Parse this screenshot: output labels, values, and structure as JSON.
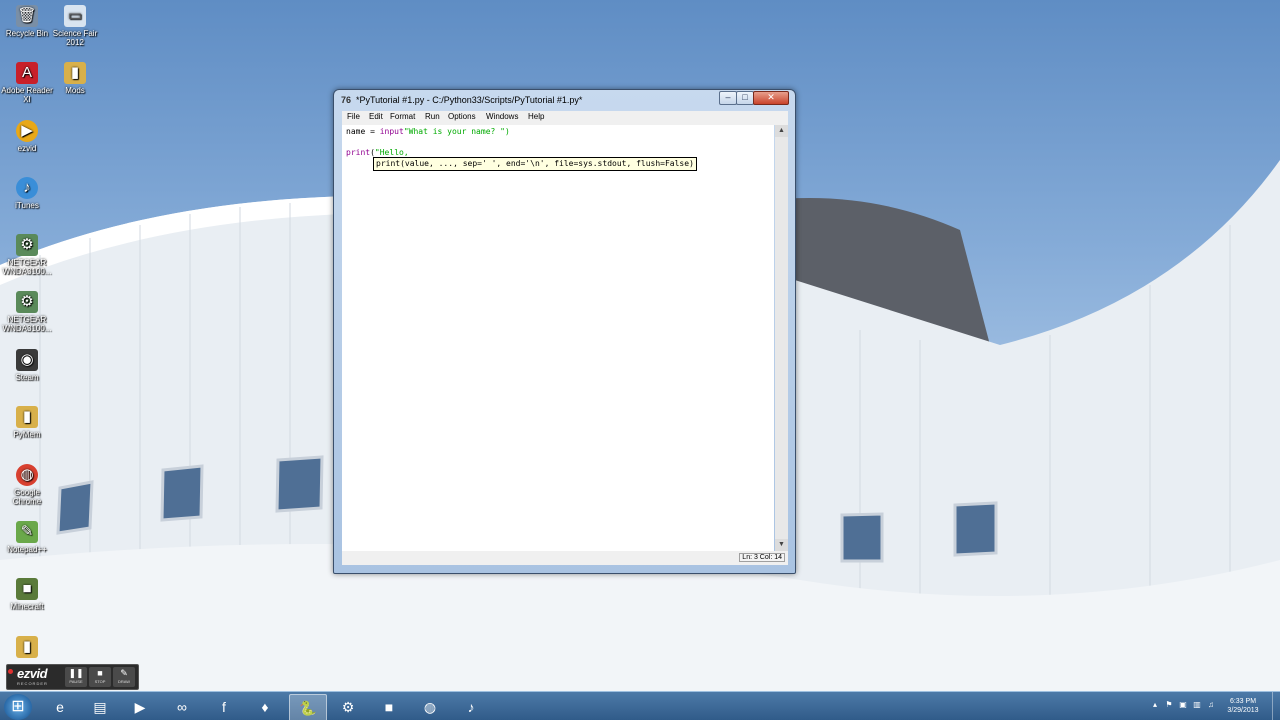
{
  "desktop": {
    "icons": [
      {
        "label": "Recycle Bin",
        "glyph": "🗑",
        "color": "#7a8fa6"
      },
      {
        "label": "Science Fair 2012",
        "glyph": "▭",
        "color": "#d8e4f0"
      },
      {
        "label": "Adobe Reader XI",
        "glyph": "A",
        "color": "#c8202a"
      },
      {
        "label": "Mods",
        "glyph": "▮",
        "color": "#d8b04a"
      },
      {
        "label": "ezvid",
        "glyph": "▶",
        "color": "#e8a818"
      },
      {
        "label": "iTunes",
        "glyph": "♪",
        "color": "#3a8ed8"
      },
      {
        "label": "NETGEAR WNDA3100...",
        "glyph": "⚙",
        "color": "#5a8a5a"
      },
      {
        "label": "NETGEAR WNDA3100...",
        "glyph": "⚙",
        "color": "#5a8a5a"
      },
      {
        "label": "Steam",
        "glyph": "◉",
        "color": "#3a3a3a"
      },
      {
        "label": "PyMem",
        "glyph": "▮",
        "color": "#d8b04a"
      },
      {
        "label": "Google Chrome",
        "glyph": "◍",
        "color": "#d84030"
      },
      {
        "label": "Notepad++",
        "glyph": "✎",
        "color": "#6aa84a"
      },
      {
        "label": "Minecraft",
        "glyph": "■",
        "color": "#5a7a3a"
      },
      {
        "label": "",
        "glyph": "▮",
        "color": "#d8b04a"
      }
    ]
  },
  "window": {
    "title": "*PyTutorial #1.py - C:/Python33/Scripts/PyTutorial #1.py*",
    "app_icon": "76",
    "minimize": "–",
    "maximize": "□",
    "close": "✕",
    "menu": [
      "File",
      "Edit",
      "Format",
      "Run",
      "Options",
      "Windows",
      "Help"
    ],
    "code": {
      "line1_var": "name = ",
      "line1_func": "input",
      "line1_str": "\"What is your name? \")",
      "line3_func": "print",
      "line3_rest": "(",
      "line3_str": "\"Hello,"
    },
    "calltip": "print(value, ..., sep=' ', end='\\n', file=sys.stdout, flush=False)",
    "status": "Ln: 3 Col: 14",
    "scroll_up": "▲",
    "scroll_down": "▼"
  },
  "recorder": {
    "logo": "ezvid",
    "subtitle": "RECORDER",
    "buttons": [
      {
        "glyph": "❚❚",
        "label": "PAUSE"
      },
      {
        "glyph": "■",
        "label": "STOP"
      },
      {
        "glyph": "✎",
        "label": "DRAW"
      }
    ]
  },
  "taskbar": {
    "start_glyph": "⊞",
    "apps": [
      {
        "name": "internet-explorer",
        "glyph": "e",
        "active": false
      },
      {
        "name": "file-explorer",
        "glyph": "▤",
        "active": false
      },
      {
        "name": "media-player",
        "glyph": "▶",
        "active": false
      },
      {
        "name": "arduino",
        "glyph": "∞",
        "active": false
      },
      {
        "name": "flash",
        "glyph": "f",
        "active": false
      },
      {
        "name": "red-app",
        "glyph": "♦",
        "active": false
      },
      {
        "name": "python-idle",
        "glyph": "🐍",
        "active": true
      },
      {
        "name": "tools",
        "glyph": "⚙",
        "active": false
      },
      {
        "name": "minecraft",
        "glyph": "■",
        "active": false
      },
      {
        "name": "chrome",
        "glyph": "◍",
        "active": false
      },
      {
        "name": "itunes",
        "glyph": "♪",
        "active": false
      }
    ],
    "time": "6:33 PM",
    "date": "3/29/2013"
  }
}
